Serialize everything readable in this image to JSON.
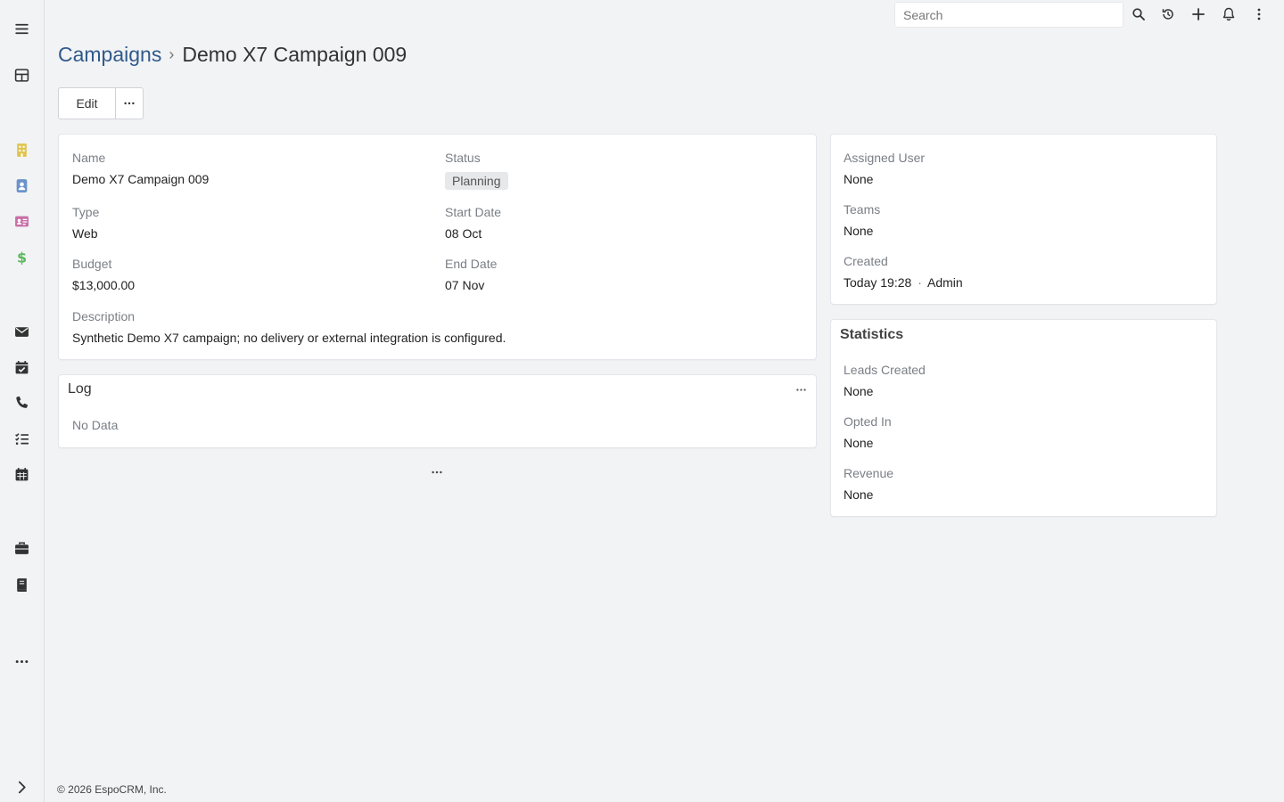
{
  "sidebar": {
    "items": [
      {
        "name": "menu-icon",
        "color": "#333333"
      },
      {
        "name": "dashboard-icon",
        "color": "#333333"
      },
      {
        "name": "accounts-icon",
        "color": "#e0c44c"
      },
      {
        "name": "contacts-icon",
        "color": "#6b93c9"
      },
      {
        "name": "leads-icon",
        "color": "#c76fa8"
      },
      {
        "name": "opportunities-icon",
        "color": "#5cb85c"
      },
      {
        "name": "email-icon",
        "color": "#333333"
      },
      {
        "name": "meetings-icon",
        "color": "#333333"
      },
      {
        "name": "calls-icon",
        "color": "#333333"
      },
      {
        "name": "tasks-icon",
        "color": "#333333"
      },
      {
        "name": "calendar-icon",
        "color": "#333333"
      },
      {
        "name": "cases-icon",
        "color": "#333333"
      },
      {
        "name": "knowledge-base-icon",
        "color": "#333333"
      },
      {
        "name": "more-icon",
        "color": "#333333"
      },
      {
        "name": "expand-icon",
        "color": "#333333"
      }
    ]
  },
  "topbar": {
    "search_placeholder": "Search",
    "icons": [
      "search-icon",
      "history-icon",
      "plus-icon",
      "bell-icon",
      "kebab-menu-icon"
    ]
  },
  "header": {
    "breadcrumb_parent": "Campaigns",
    "breadcrumb_separator": "›",
    "title": "Demo X7 Campaign 009"
  },
  "actions": {
    "edit_label": "Edit"
  },
  "overview": {
    "name_label": "Name",
    "name_value": "Demo X7 Campaign 009",
    "status_label": "Status",
    "status_value": "Planning",
    "type_label": "Type",
    "type_value": "Web",
    "start_label": "Start Date",
    "start_value": "08 Oct",
    "budget_label": "Budget",
    "budget_value": "$13,000.00",
    "end_label": "End Date",
    "end_value": "07 Nov",
    "description_label": "Description",
    "description_value": "Synthetic Demo X7 campaign; no delivery or external integration is configured."
  },
  "log": {
    "title": "Log",
    "empty_text": "No Data"
  },
  "side_panel": {
    "assigned_user_label": "Assigned User",
    "assigned_user_value": "None",
    "teams_label": "Teams",
    "teams_value": "None",
    "created_label": "Created",
    "created_value": "Today 19:28",
    "created_separator": "·",
    "created_by": "Admin"
  },
  "statistics": {
    "title": "Statistics",
    "leads_label": "Leads Created",
    "leads_value": "None",
    "opted_label": "Opted In",
    "opted_value": "None",
    "revenue_label": "Revenue",
    "revenue_value": "None"
  },
  "footer": {
    "text": "© 2026 EspoCRM, Inc."
  }
}
